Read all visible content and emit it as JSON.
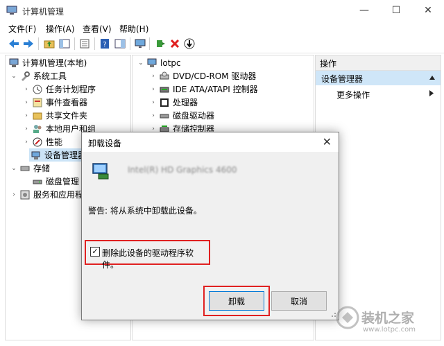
{
  "window": {
    "title": "计算机管理",
    "controls": {
      "minimize": "—",
      "maximize": "☐",
      "close": "✕"
    }
  },
  "menu": [
    "文件(F)",
    "操作(A)",
    "查看(V)",
    "帮助(H)"
  ],
  "tree": {
    "root": "计算机管理(本地)",
    "system_tools": "系统工具",
    "items": [
      "任务计划程序",
      "事件查看器",
      "共享文件夹",
      "本地用户和组",
      "性能",
      "设备管理器"
    ],
    "storage": "存储",
    "disk_mgmt": "磁盘管理",
    "services": "服务和应用程序"
  },
  "devices": {
    "root": "lotpc",
    "items": [
      "DVD/CD-ROM 驱动器",
      "IDE ATA/ATAPI 控制器",
      "处理器",
      "磁盘驱动器",
      "存储控制器"
    ]
  },
  "actions": {
    "header": "操作",
    "device_manager": "设备管理器",
    "more": "更多操作"
  },
  "dialog": {
    "title": "卸载设备",
    "device_name": "Intel(R) HD Graphics 4600",
    "warning": "警告: 将从系统中卸载此设备。",
    "checkbox_label": "删除此设备的驱动程序软件。",
    "checkbox_checked": "✓",
    "uninstall_label": "卸载",
    "cancel_label": "取消"
  },
  "watermark": {
    "brand": "装机之家",
    "url": "www.lotpc.com"
  },
  "colors": {
    "selection": "#cce4f7",
    "highlight_border": "#e02020",
    "accent": "#0078d7"
  }
}
